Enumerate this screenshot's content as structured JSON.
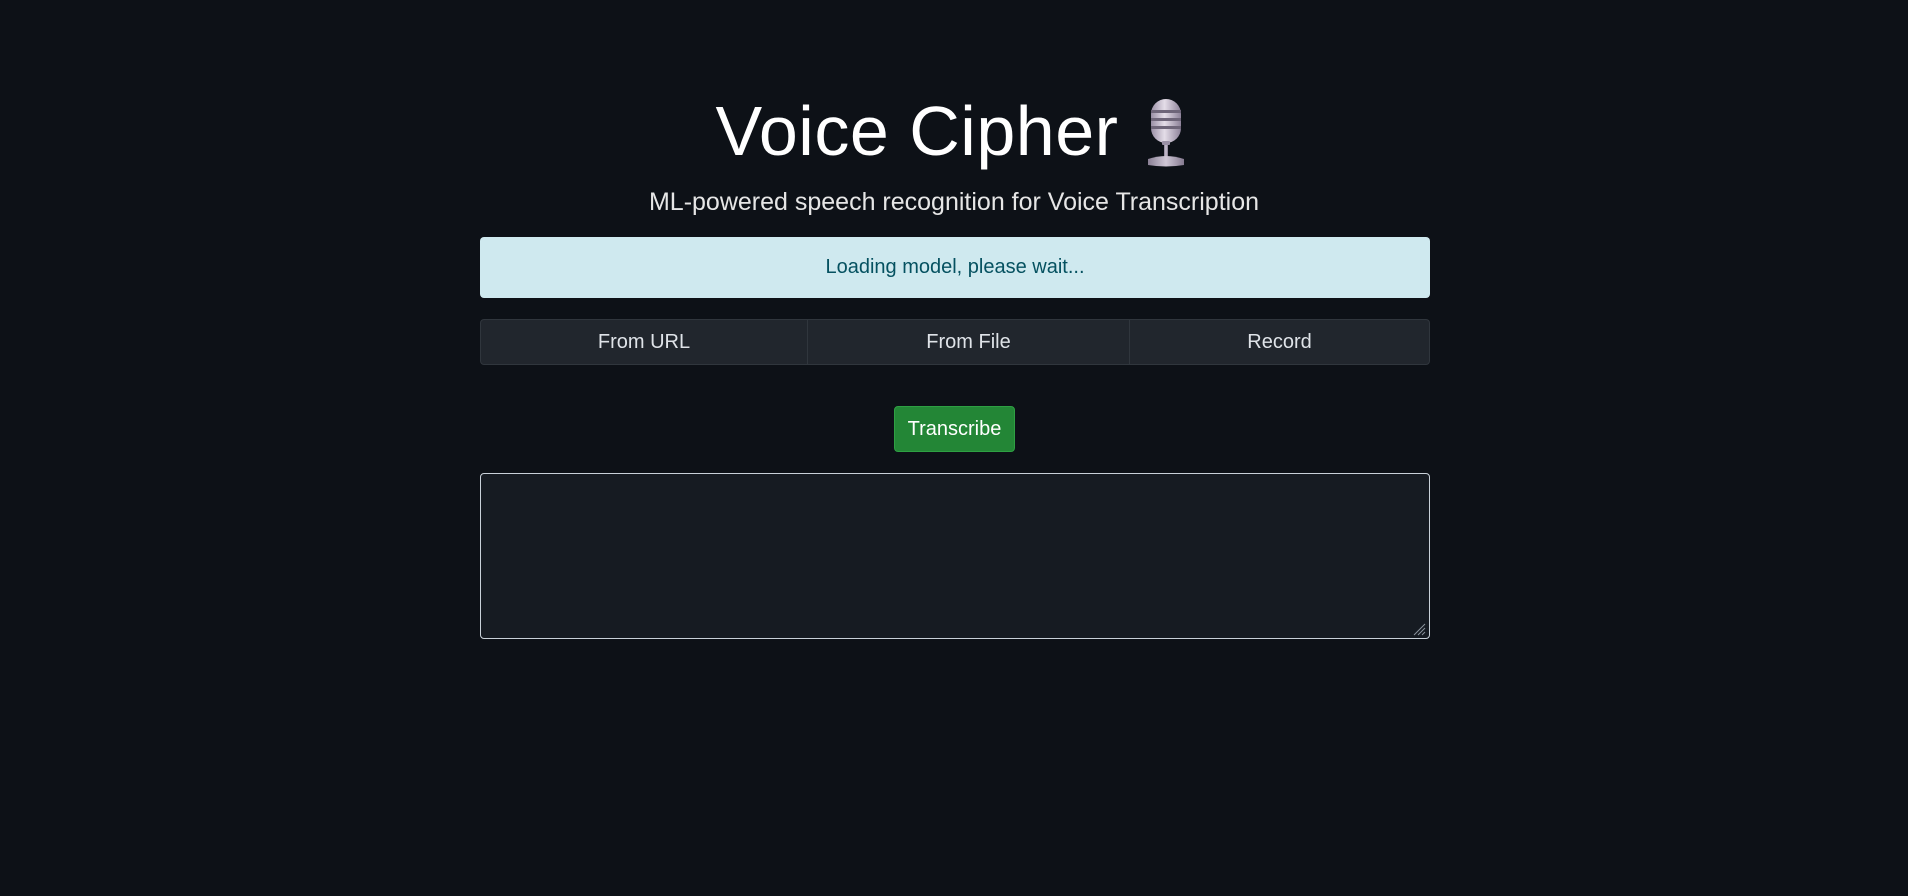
{
  "header": {
    "title": "Voice Cipher",
    "title_icon": "microphone-icon",
    "subtitle": "ML-powered speech recognition for Voice Transcription"
  },
  "status": {
    "message": "Loading model, please wait..."
  },
  "source_tabs": [
    {
      "label": "From URL"
    },
    {
      "label": "From File"
    },
    {
      "label": "Record"
    }
  ],
  "actions": {
    "transcribe_label": "Transcribe"
  },
  "output": {
    "value": "",
    "placeholder": ""
  },
  "colors": {
    "background": "#0d1117",
    "alert_bg": "#cfe9ef",
    "alert_text": "#055160",
    "button_green": "#238636",
    "panel": "#21262d"
  }
}
